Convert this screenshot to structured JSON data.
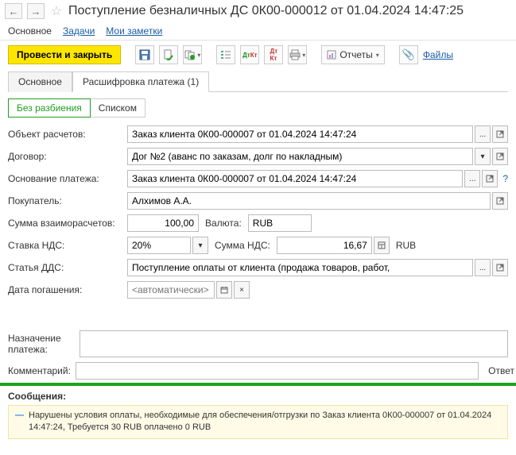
{
  "header": {
    "title": "Поступление безналичных ДС 0К00-000012 от 01.04.2024 14:47:25"
  },
  "subnav": {
    "main": "Основное",
    "tasks": "Задачи",
    "notes": "Мои заметки"
  },
  "toolbar": {
    "post_and_close": "Провести и закрыть",
    "reports": "Отчеты",
    "files": "Файлы"
  },
  "tabs": {
    "main": "Основное",
    "decode": "Расшифровка платежа (1)"
  },
  "subtabs": {
    "no_split": "Без разбиения",
    "list": "Списком"
  },
  "form": {
    "object_label": "Объект расчетов:",
    "object_value": "Заказ клиента 0К00-000007 от 01.04.2024 14:47:24",
    "contract_label": "Договор:",
    "contract_value": "Дог №2 (аванс по заказам, долг по накладным)",
    "basis_label": "Основание платежа:",
    "basis_value": "Заказ клиента 0К00-000007 от 01.04.2024 14:47:24",
    "buyer_label": "Покупатель:",
    "buyer_value": "Алхимов А.А.",
    "sum_label": "Сумма взаиморасчетов:",
    "sum_value": "100,00",
    "currency_label": "Валюта:",
    "currency_value": "RUB",
    "vat_rate_label": "Ставка НДС:",
    "vat_rate_value": "20%",
    "vat_sum_label": "Сумма НДС:",
    "vat_sum_value": "16,67",
    "vat_currency": "RUB",
    "dds_label": "Статья ДДС:",
    "dds_value": "Поступление оплаты от клиента (продажа товаров, работ, ",
    "pay_date_label": "Дата погашения:",
    "pay_date_placeholder": "<автоматически>"
  },
  "bottom": {
    "purpose_label": "Назначение платежа:",
    "comment_label": "Комментарий:",
    "responsible_label": "Ответ"
  },
  "messages": {
    "title": "Сообщения:",
    "items": [
      "Нарушены условия оплаты, необходимые для обеспечения/отгрузки по Заказ клиента 0К00-000007 от 01.04.2024 14:47:24, Требуется 30 RUB оплачено 0 RUB"
    ]
  }
}
